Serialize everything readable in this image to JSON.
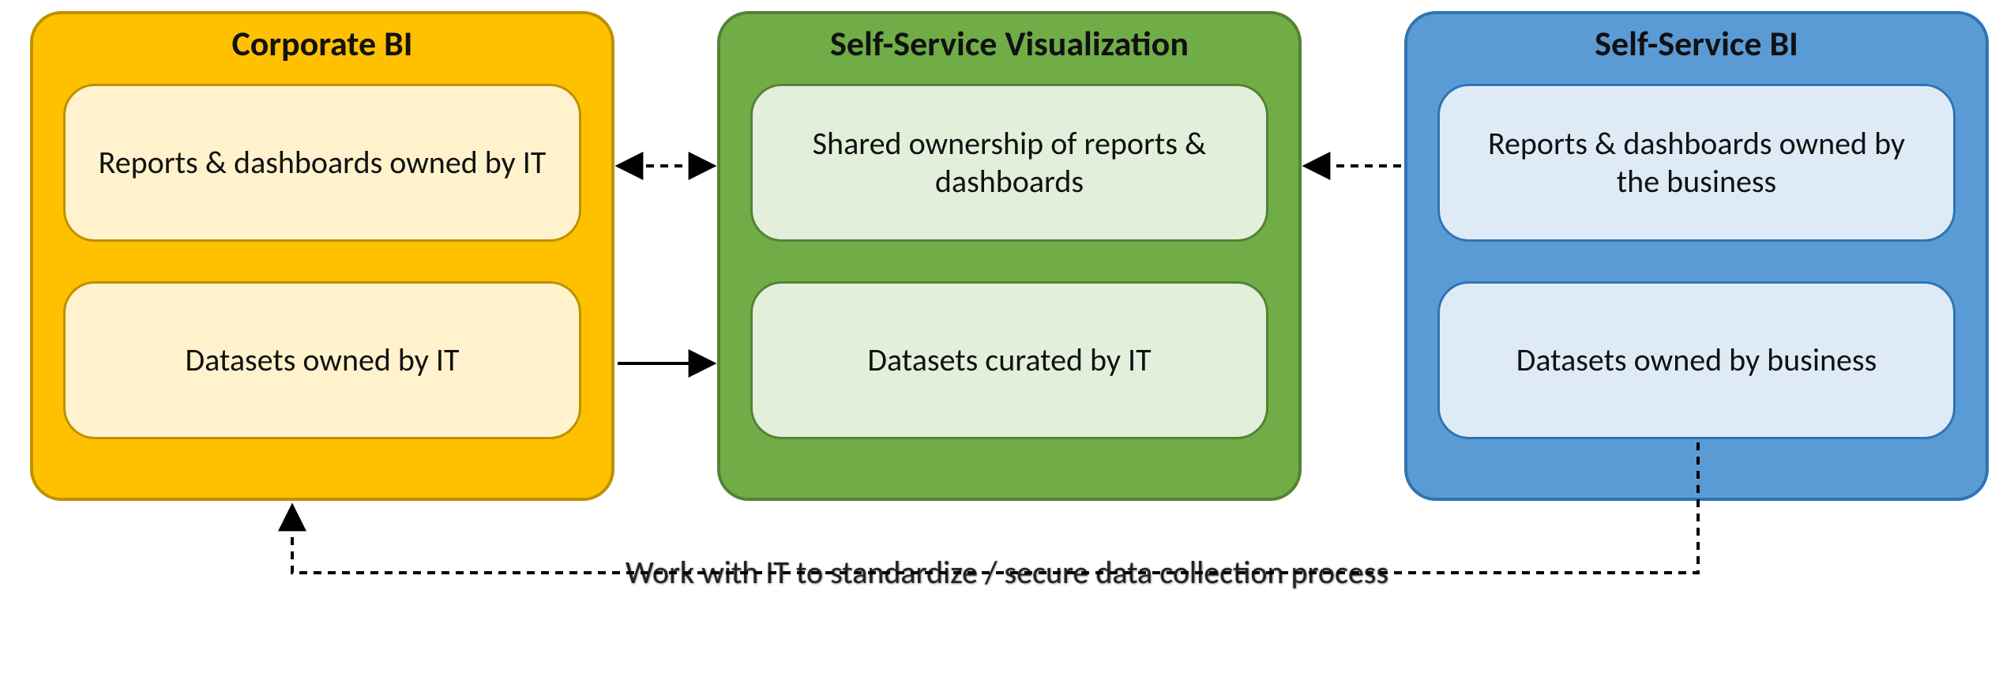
{
  "panels": {
    "corporate": {
      "title": "Corporate BI",
      "box1": "Reports & dashboards owned by IT",
      "box2": "Datasets owned by IT"
    },
    "ssv": {
      "title": "Self-Service Visualization",
      "box1": "Shared ownership of reports & dashboards",
      "box2": "Datasets curated by IT"
    },
    "ssbi": {
      "title": "Self-Service BI",
      "box1": "Reports & dashboards owned by the business",
      "box2": "Datasets owned by business"
    }
  },
  "bottom_caption": "Work with IT to standardize / secure data collection process",
  "colors": {
    "corp_bg": "#ffc000",
    "corp_border": "#bf9000",
    "corp_inner": "#fff2cc",
    "ssv_bg": "#70ad47",
    "ssv_border": "#548235",
    "ssv_inner": "#e2efda",
    "ssbi_bg": "#5b9bd5",
    "ssbi_border": "#2e74b5",
    "ssbi_inner": "#deebf7"
  }
}
